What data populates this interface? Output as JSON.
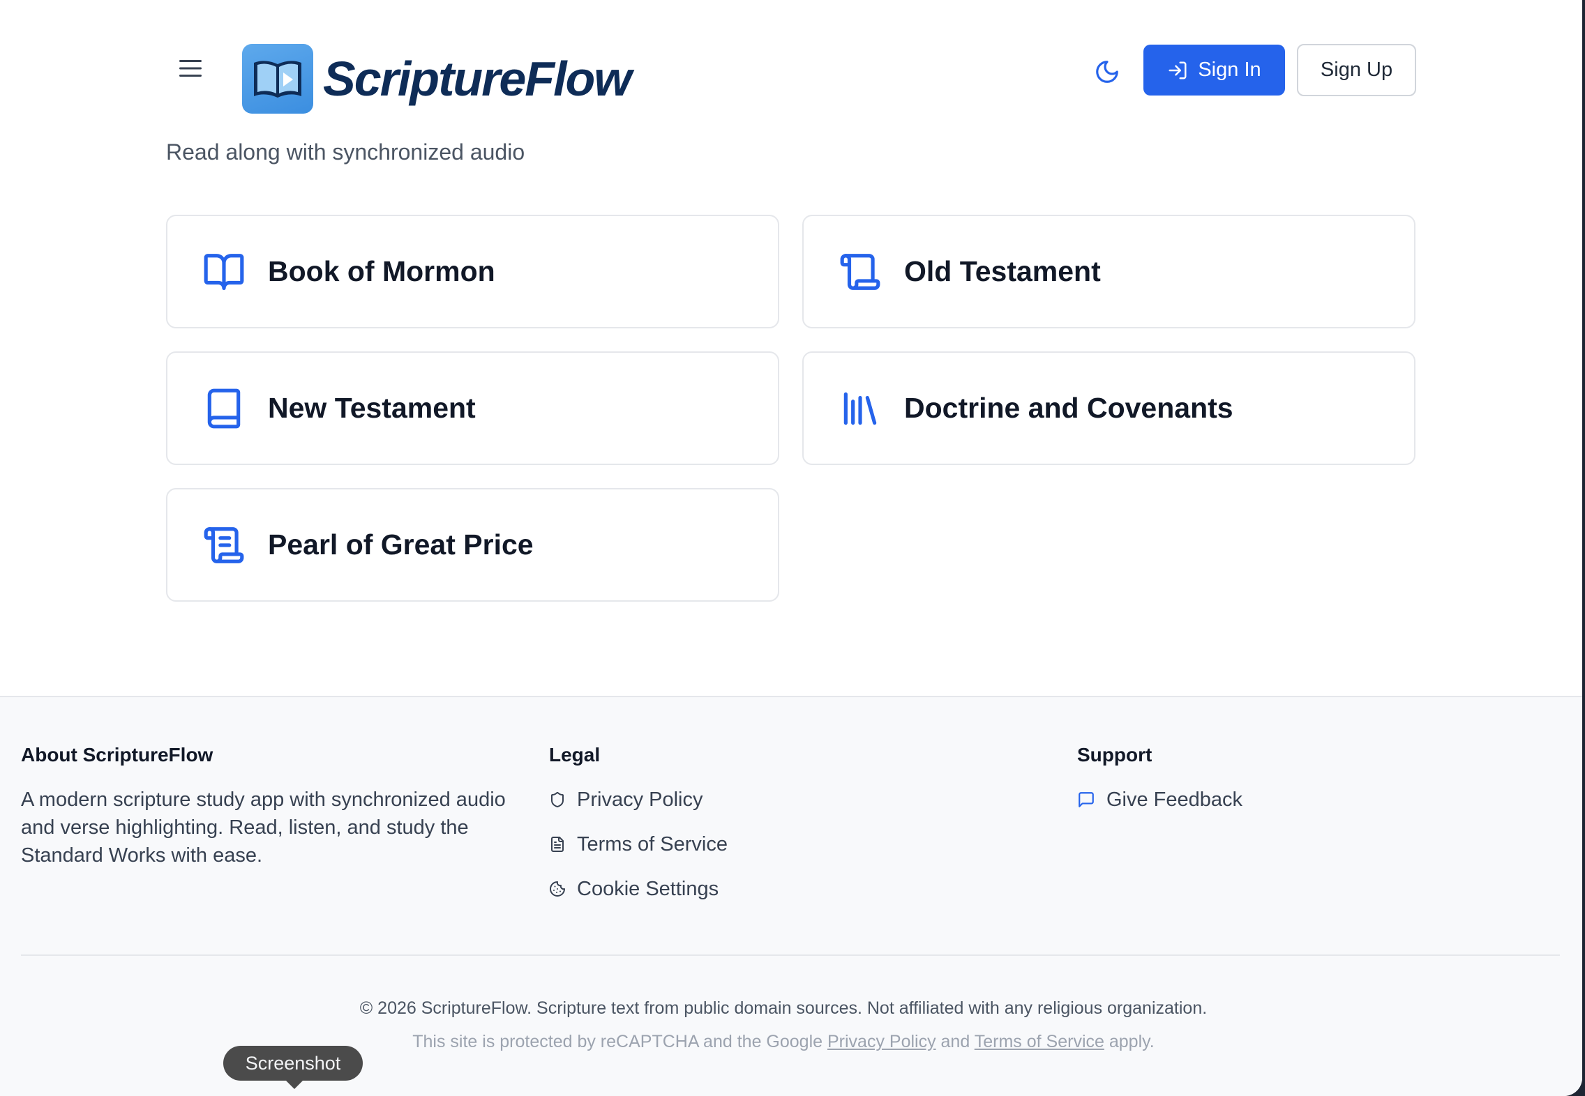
{
  "header": {
    "brand": "ScriptureFlow",
    "sign_in_label": "Sign In",
    "sign_up_label": "Sign Up"
  },
  "tagline": "Read along with synchronized audio",
  "books": [
    {
      "label": "Book of Mormon",
      "icon": "open-book-icon"
    },
    {
      "label": "Old Testament",
      "icon": "scroll-icon"
    },
    {
      "label": "New Testament",
      "icon": "book-icon"
    },
    {
      "label": "Doctrine and Covenants",
      "icon": "library-icon"
    },
    {
      "label": "Pearl of Great Price",
      "icon": "scroll-text-icon"
    }
  ],
  "footer": {
    "about": {
      "title": "About ScriptureFlow",
      "text": "A modern scripture study app with synchronized audio and verse highlighting. Read, listen, and study the Standard Works with ease."
    },
    "legal": {
      "title": "Legal",
      "links": [
        "Privacy Policy",
        "Terms of Service",
        "Cookie Settings"
      ]
    },
    "support": {
      "title": "Support",
      "links": [
        "Give Feedback"
      ]
    },
    "copyright": "© 2026 ScriptureFlow. Scripture text from public domain sources. Not affiliated with any religious organization.",
    "recaptcha": {
      "prefix": "This site is protected by reCAPTCHA and the Google",
      "privacy": "Privacy Policy",
      "and": "and",
      "terms": "Terms of Service",
      "suffix": "apply."
    }
  },
  "tooltip": "Screenshot",
  "colors": {
    "accent": "#2563eb",
    "brand_text": "#0e2c57",
    "logo_tile": "#4a9be6"
  }
}
